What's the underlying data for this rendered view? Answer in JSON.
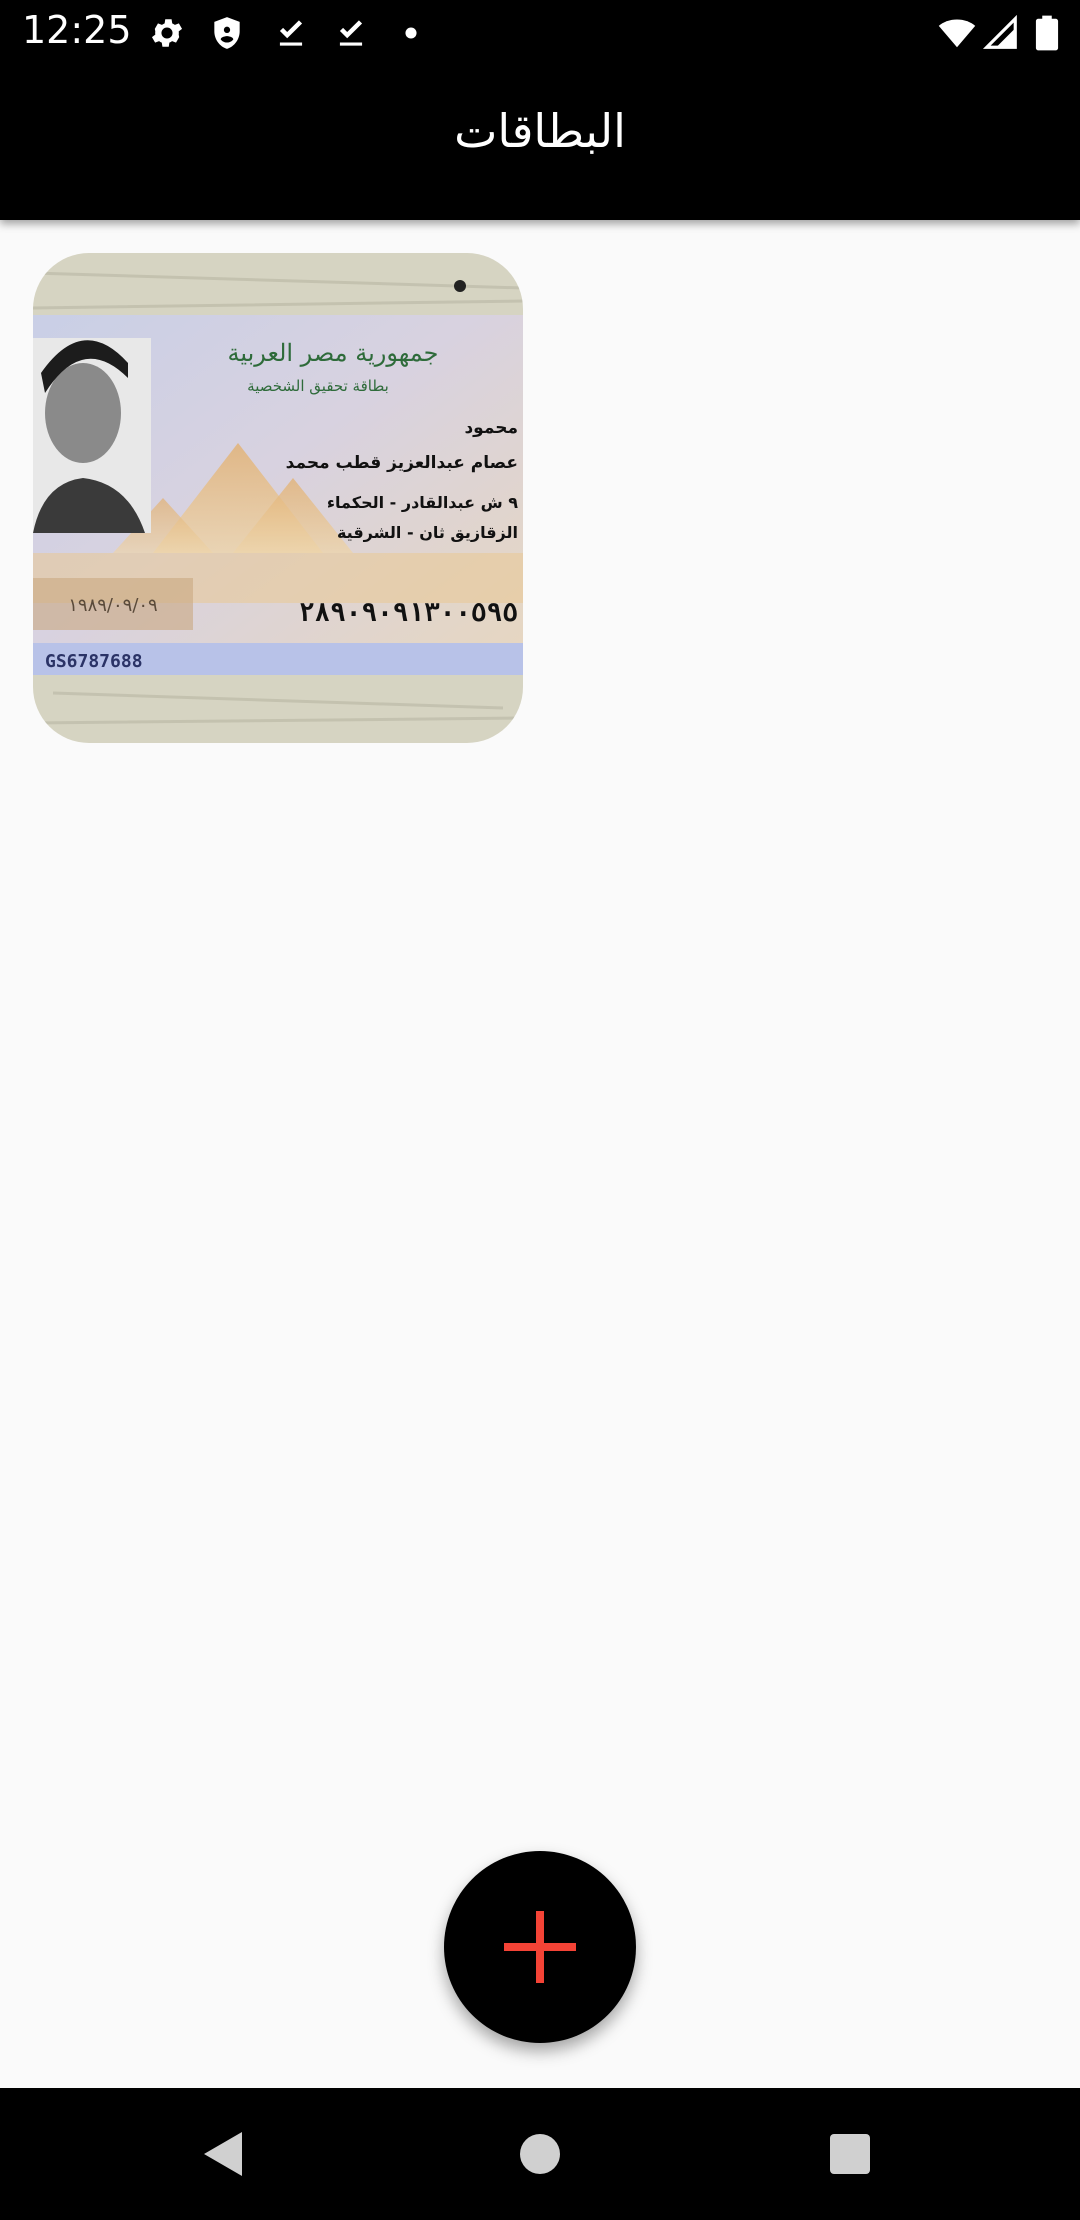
{
  "status_bar": {
    "time": "12:25",
    "icons": [
      "gear-icon",
      "shield-icon",
      "download-done-icon",
      "download-done-icon",
      "dot-icon",
      "wifi-icon",
      "signal-icon",
      "battery-icon"
    ]
  },
  "app_bar": {
    "title": "البطاقات"
  },
  "cards": [
    {
      "image": "egyptian-national-id-card-photo",
      "header_text": "جمهورية مصر العربية",
      "subheader_text": "بطاقة تحقيق الشخصية",
      "first_name": "محمود",
      "full_name": "عصام عبدالعزيز قطب محمد",
      "address_line1": "٩ ش عبدالقادر - الحكماء",
      "address_line2": "الزقازيق ثان - الشرقية",
      "birth_date": "١٩٨٩/٠٩/٠٩",
      "id_number": "٢٨٩٠٩٠٩١٣٠٠٥٩٥",
      "serial": "GS6787688"
    }
  ],
  "fab": {
    "icon": "plus-icon",
    "color": "#f44336"
  },
  "nav_bar": {
    "icons": [
      "back-icon",
      "home-icon",
      "recents-icon"
    ]
  },
  "colors": {
    "bar": "#000000",
    "background": "#fafafa",
    "accent": "#f44336"
  }
}
